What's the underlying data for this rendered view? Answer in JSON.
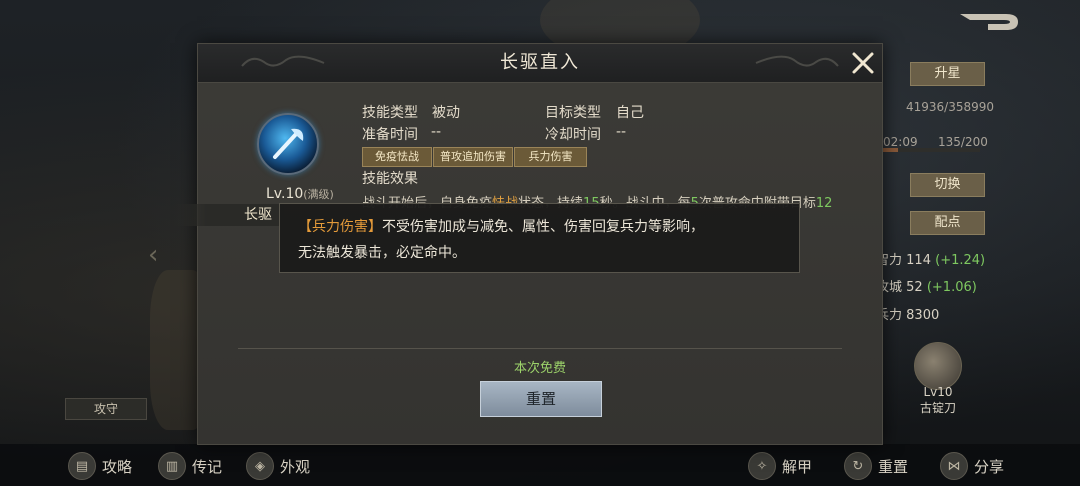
{
  "modal": {
    "title": "长驱直入",
    "skill": {
      "level": "Lv.10",
      "level_note": "(满级)",
      "name_short": "长驱",
      "type_label": "技能类型",
      "type_value": "被动",
      "target_label": "目标类型",
      "target_value": "自己",
      "prep_label": "准备时间",
      "prep_value": "--",
      "cooldown_label": "冷却时间",
      "cooldown_value": "--",
      "tags": [
        "免疫怯战",
        "普攻追加伤害",
        "兵力伤害"
      ],
      "effect_label": "技能效果",
      "effect_parts": [
        "战斗开始后，自身免疫",
        "怯战",
        "状态，持续",
        "15",
        "秒。战斗中，每",
        "5",
        "次普攻命中附带目标",
        "12"
      ]
    },
    "free_text": "本次免费",
    "reset_label": "重置"
  },
  "tooltip": {
    "keyword": "【兵力伤害】",
    "line1_rest": "不受伤害加成与减免、属性、伤害回复兵力等影响，",
    "line2": "无法触发暴击，必定命中。"
  },
  "right_panel": {
    "upgrade_label": "升星",
    "exp_text": "41936/358990",
    "timer_text": "02:09",
    "stamina_text": "135/200",
    "switch_label": "切换",
    "allocate_label": "配点",
    "stats": [
      {
        "label": "智力",
        "value": "114",
        "bonus": "(+1.24)"
      },
      {
        "label": "攻城",
        "value": "52",
        "bonus": "(+1.06)"
      },
      {
        "label": "兵力",
        "value": "8300",
        "bonus": ""
      }
    ],
    "weapon_level": "Lv10",
    "weapon_name": "古锭刀"
  },
  "left_panel": {
    "attack_defense_label": "攻守"
  },
  "bottom_bar": {
    "left": [
      {
        "label": "攻略",
        "icon": "book-icon"
      },
      {
        "label": "传记",
        "icon": "scroll-icon"
      },
      {
        "label": "外观",
        "icon": "helmet-icon"
      }
    ],
    "right": [
      {
        "label": "解甲",
        "icon": "dragon-icon"
      },
      {
        "label": "重置",
        "icon": "reset-icon"
      },
      {
        "label": "分享",
        "icon": "share-icon"
      }
    ]
  },
  "colors": {
    "keyword_orange": "#e39a3a",
    "bonus_green": "#7ec860",
    "free_green": "#9cd26a",
    "tag_gold": "#6b5a38"
  }
}
